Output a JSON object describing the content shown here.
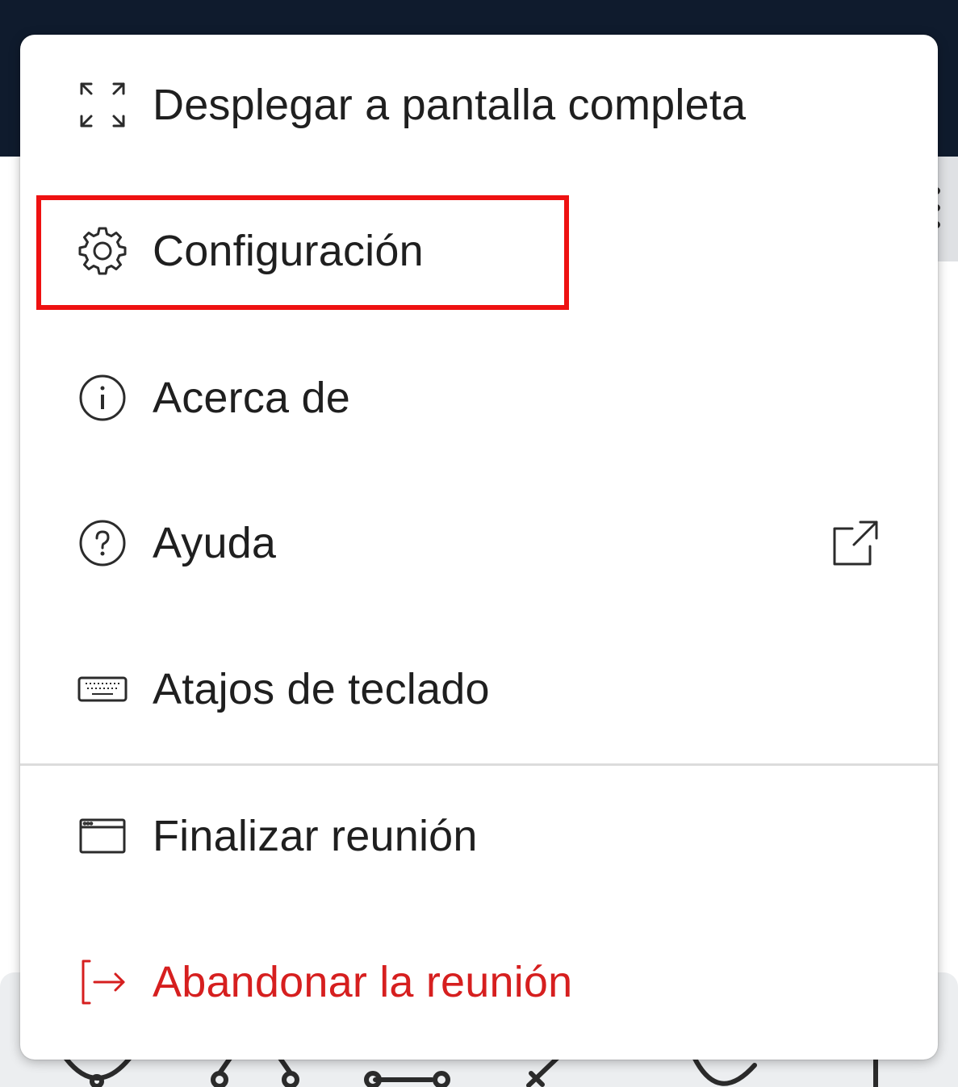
{
  "menu": {
    "items": [
      {
        "label": "Desplegar a pantalla completa",
        "icon": "fullscreen-expand-icon"
      },
      {
        "label": "Configuración",
        "icon": "gear-icon"
      },
      {
        "label": "Acerca de",
        "icon": "info-icon"
      },
      {
        "label": "Ayuda",
        "icon": "help-icon",
        "trailing_icon": "external-link-icon"
      },
      {
        "label": "Atajos de teclado",
        "icon": "keyboard-icon"
      },
      {
        "label": "Finalizar reunión",
        "icon": "window-icon"
      },
      {
        "label": "Abandonar la reunión",
        "icon": "leave-icon"
      }
    ]
  },
  "highlight": {
    "target": "Configuración",
    "color": "#ee1111"
  },
  "colors": {
    "topbar": "#0f1b2d",
    "text": "#1f1f1f",
    "danger": "#d61f1f",
    "divider": "#dcdcdc"
  }
}
